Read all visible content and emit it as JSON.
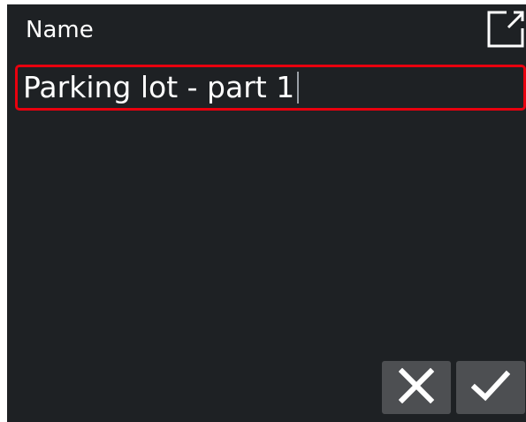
{
  "field": {
    "label": "Name",
    "value": "Parking lot - part 1"
  },
  "icons": {
    "expand": "expand-icon",
    "cancel": "close-icon",
    "confirm": "checkmark-icon"
  },
  "colors": {
    "background": "#1e2124",
    "text": "#ffffff",
    "focus_border": "#e8000e",
    "button_bg": "#4d4f52"
  }
}
